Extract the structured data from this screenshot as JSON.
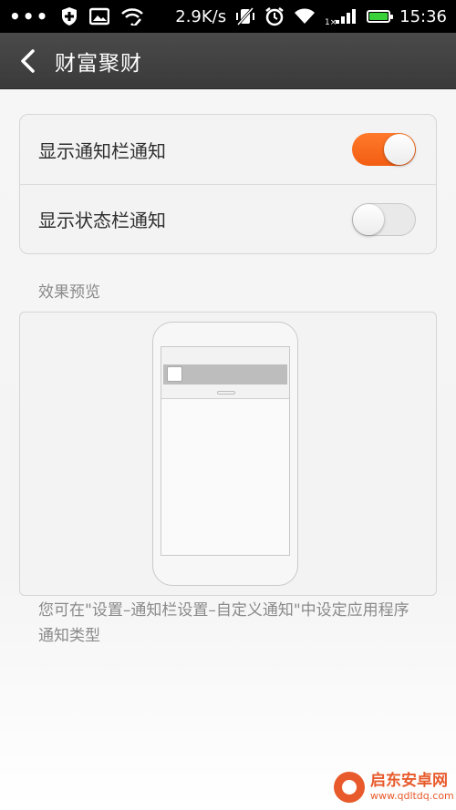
{
  "status_bar": {
    "dots": "•••",
    "net_speed": "2.9K/s",
    "signal_label": "1×",
    "time": "15:36"
  },
  "header": {
    "title": "财富聚财"
  },
  "settings": {
    "rows": [
      {
        "label": "显示通知栏通知",
        "enabled": true
      },
      {
        "label": "显示状态栏通知",
        "enabled": false
      }
    ]
  },
  "preview": {
    "section_label": "效果预览"
  },
  "footer": {
    "note": "您可在\"设置–通知栏设置–自定义通知\"中设定应用程序通知类型"
  },
  "watermark": {
    "main": "启东安卓网",
    "url": "www.qdltdq.com"
  },
  "colors": {
    "accent": "#f46a1f",
    "header_bg": "#3f3f3f",
    "watermark": "#e85a2b"
  }
}
